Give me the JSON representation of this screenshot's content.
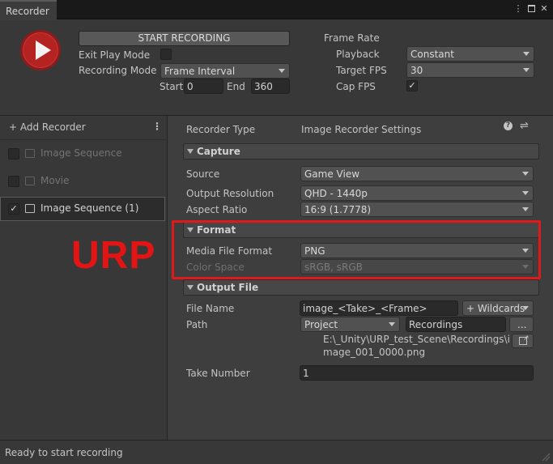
{
  "window": {
    "tab_title": "Recorder",
    "menu_icon": "kebab-menu-icon",
    "maximize_icon": "maximize-icon",
    "close_icon": "close-icon"
  },
  "top": {
    "start_label": "START RECORDING",
    "exit_play_mode_label": "Exit Play Mode",
    "exit_play_mode_checked": false,
    "recording_mode_label": "Recording Mode",
    "recording_mode_value": "Frame Interval",
    "start_label_small": "Start",
    "start_value": "0",
    "end_label": "End",
    "end_value": "360",
    "frame_rate_label": "Frame Rate",
    "playback_label": "Playback",
    "playback_value": "Constant",
    "target_fps_label": "Target FPS",
    "target_fps_value": "30",
    "cap_fps_label": "Cap FPS",
    "cap_fps_checked": true,
    "check_glyph": "✓"
  },
  "left": {
    "add_recorder": "+ Add Recorder",
    "menu_glyph": "⋮",
    "items": [
      {
        "label": "Image Sequence",
        "enabled": false,
        "icon": "image-icon"
      },
      {
        "label": "Movie",
        "enabled": false,
        "icon": "movie-icon"
      },
      {
        "label": "Image Sequence (1)",
        "enabled": true,
        "icon": "image-icon"
      }
    ]
  },
  "right": {
    "recorder_type_label": "Recorder Type",
    "recorder_type_value": "Image Recorder Settings",
    "help_glyph": "?",
    "preset_glyph": "⇌",
    "capture": {
      "title": "Capture",
      "source_label": "Source",
      "source_value": "Game View",
      "resolution_label": "Output Resolution",
      "resolution_value": "QHD - 1440p",
      "aspect_label": "Aspect Ratio",
      "aspect_value": "16:9 (1.7778)"
    },
    "format": {
      "title": "Format",
      "media_label": "Media File Format",
      "media_value": "PNG",
      "color_label": "Color Space",
      "color_value": "sRGB, sRGB"
    },
    "output": {
      "title": "Output File",
      "filename_label": "File Name",
      "filename_value": "image_<Take>_<Frame>",
      "wildcards_label": "+ Wildcards",
      "path_label": "Path",
      "path_root": "Project",
      "path_value": "Recordings",
      "browse_label": "...",
      "full_path_line1": "E:\\_Unity\\URP_test_Scene\\Recordings\\i",
      "full_path_line2": "mage_001_0000.png",
      "take_label": "Take Number",
      "take_value": "1"
    }
  },
  "annotation": {
    "text": "URP",
    "color": "#e31414"
  },
  "status": {
    "text": "Ready to start recording"
  },
  "colors": {
    "background": "#383838",
    "panel": "#3e3e3e",
    "record_button": "#b52222",
    "highlight_box": "#e01a1a"
  }
}
